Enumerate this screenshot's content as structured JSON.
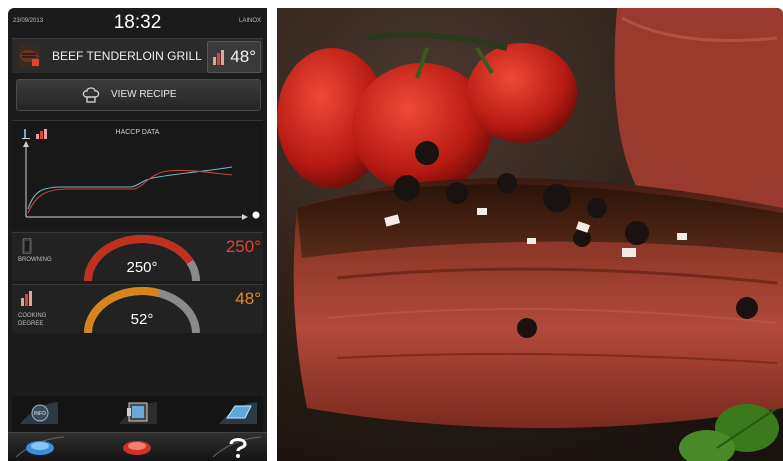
{
  "status": {
    "date": "23/09/2013",
    "time": "18:32",
    "brand": "LAINOX"
  },
  "recipe": {
    "title": "BEEF TENDERLOIN GRILL",
    "core_temp": "48°"
  },
  "view_recipe": {
    "label": "VIEW RECIPE"
  },
  "haccp": {
    "title": "HACCP DATA"
  },
  "browning": {
    "label": "BROWNING",
    "target": "250°",
    "current": "250°",
    "level": 0.85
  },
  "cooking_degree": {
    "label_line1": "COOKING",
    "label_line2": "DEGREE",
    "target": "48°",
    "current": "52°",
    "level": 0.6
  },
  "toolbar": {
    "info_label": "INFO"
  },
  "colors": {
    "accent_red": "#e0442e",
    "accent_orange": "#e4882a",
    "gauge_red": "#c0301f",
    "gauge_orange": "#d8841c",
    "chart_blue": "#7fb0c8",
    "chart_red": "#c2483a",
    "nav_blue": "#3a8fd8",
    "nav_red": "#d0302a"
  },
  "icons": [
    "grill-recipe-icon",
    "core-probe-icon",
    "chef-hat-icon",
    "browning-icon",
    "cooking-degree-icon",
    "info-icon",
    "oven-door-icon",
    "tray-icon",
    "home-icon",
    "start-icon",
    "help-icon"
  ]
}
